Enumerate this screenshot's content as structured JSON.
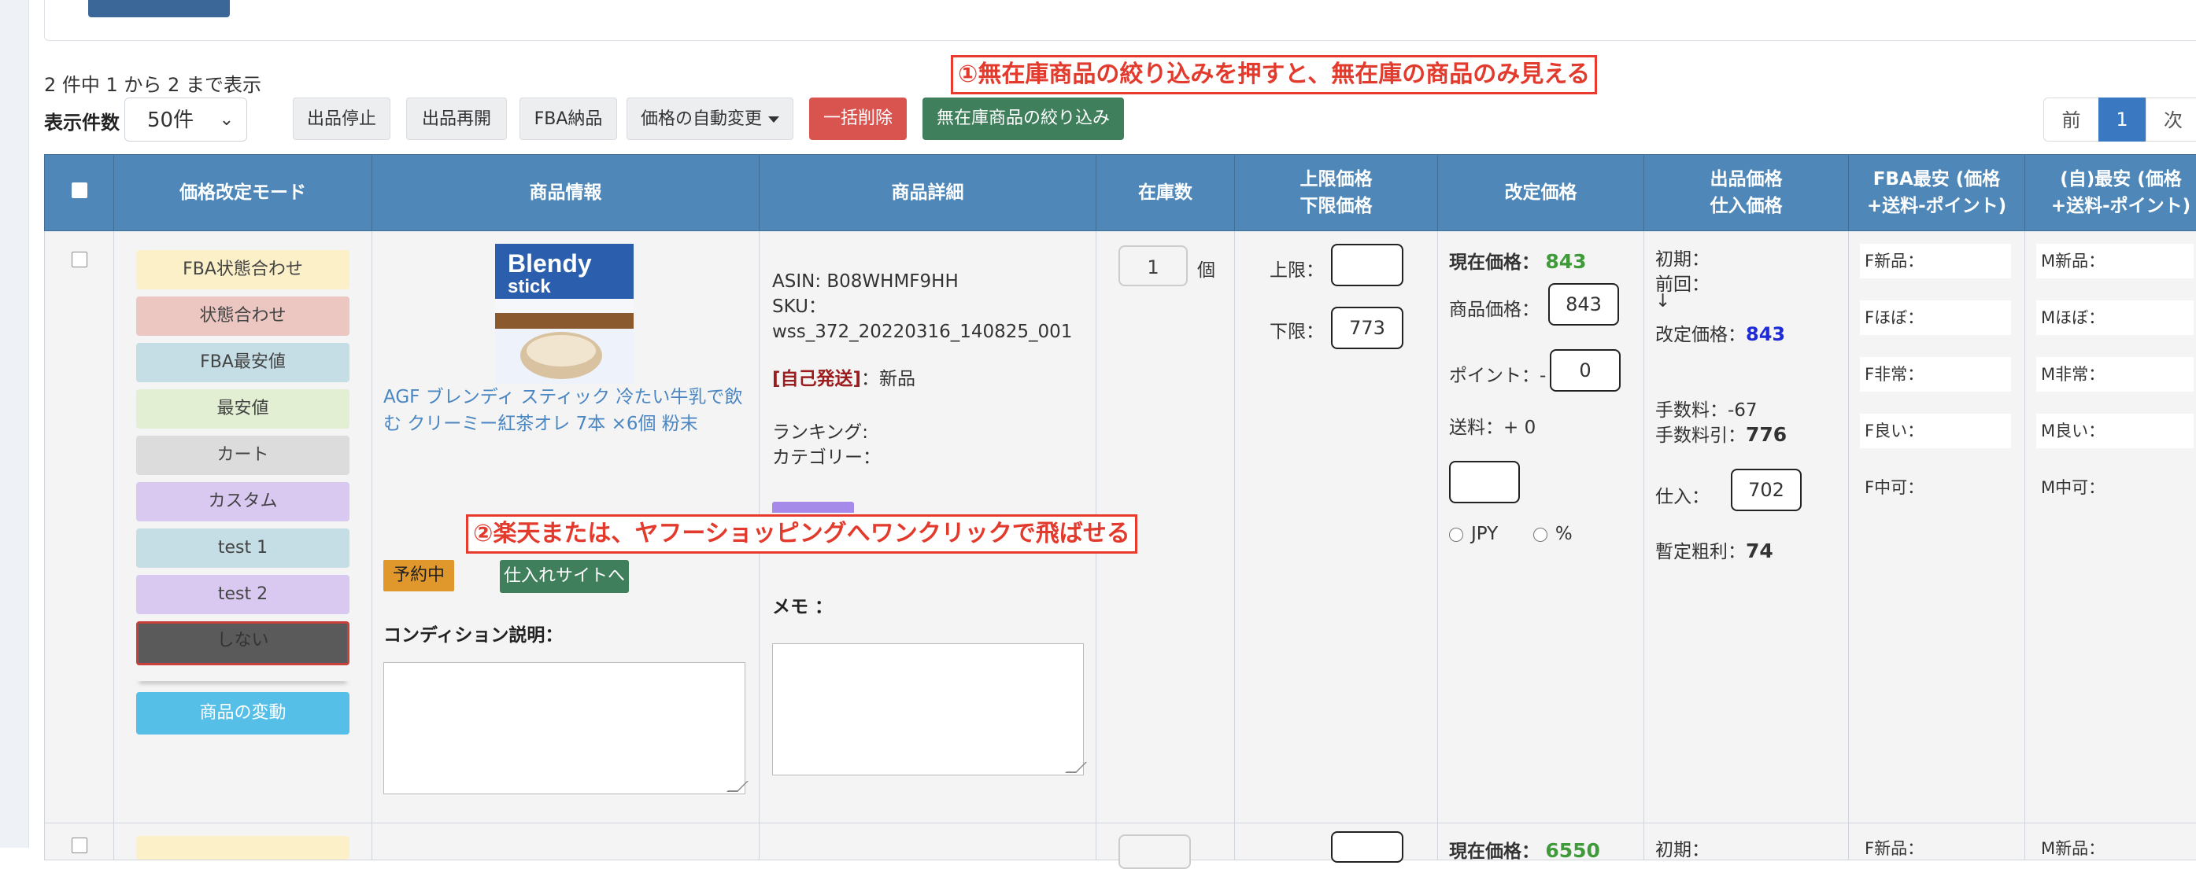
{
  "toolbar": {
    "count_text": "2 件中 1 から 2 まで表示",
    "per_page_label": "表示件数",
    "per_page_value": "50件",
    "stop_listing": "出品停止",
    "resume_listing": "出品再開",
    "fba_delivery": "FBA納品",
    "auto_price_change": "価格の自動変更",
    "bulk_delete": "一括削除",
    "filter_out_of_stock": "無在庫商品の絞り込み"
  },
  "pager": {
    "prev": "前",
    "current": "1",
    "next": "次"
  },
  "annotations": {
    "callout1": "①無在庫商品の絞り込みを押すと、無在庫の商品のみ見える",
    "callout2": "②楽天または、ヤフーショッピングへワンクリックで飛ばせる"
  },
  "table": {
    "headers": {
      "mode": "価格改定モード",
      "product_info": "商品情報",
      "product_detail": "商品詳細",
      "stock": "在庫数",
      "limits_1": "上限価格",
      "limits_2": "下限価格",
      "revised_price": "改定価格",
      "listing_1": "出品価格",
      "listing_2": "仕入価格",
      "fba_low_1": "FBA最安 (価格",
      "fba_low_2": "+送料-ポイント)",
      "self_low_1": "(自)最安 (価格",
      "self_low_2": "+送料-ポイント)"
    },
    "row1": {
      "modes": [
        "FBA状態合わせ",
        "状態合わせ",
        "FBA最安値",
        "最安値",
        "カート",
        "カスタム",
        "test 1",
        "test 2",
        "しない"
      ],
      "change_button": "商品の変動",
      "product_title": "AGF ブレンディ スティック 冷たい牛乳で飲む クリーミー紅茶オレ 7本 ×6個 粉末",
      "reserved_badge": "予約中",
      "supplier_button": "仕入れサイトへ",
      "condition_label": "コンディション説明：",
      "asin": "ASIN: B08WHMF9HH",
      "sku_label": "SKU：",
      "sku_value": "wss_372_20220316_140825_001",
      "self_ship": "[自己発送]",
      "condition": "：新品",
      "ranking": "ランキング:",
      "category": "カテゴリー：",
      "memo_label": "メモ ：",
      "stock_value": "1",
      "stock_unit": "個",
      "upper_label": "上限：",
      "upper_value": "",
      "lower_label": "下限：",
      "lower_value": "773",
      "current_price_label": "現在価格：",
      "current_price": "843",
      "item_price_label": "商品価格：",
      "item_price": "843",
      "point_label": "ポイント：-",
      "point_value": "0",
      "shipping_label": "送料：+ 0",
      "jpy_label": "JPY",
      "percent_label": "%",
      "initial_label": "初期：",
      "previous_label": "前回：",
      "arrow": "↓",
      "revised_label": "改定価格：",
      "revised_value": "843",
      "fee_text": "手数料：-67",
      "after_fee_label": "手数料引：",
      "after_fee_value": "776",
      "purchase_label": "仕入：",
      "purchase_value": "702",
      "gross_label": "暫定粗利：",
      "gross_value": "74",
      "fba_rows": [
        "F新品：",
        "Fほぼ：",
        "F非常：",
        "F良い：",
        "F中可："
      ],
      "self_rows": [
        "M新品：",
        "Mほぼ：",
        "M非常：",
        "M良い：",
        "M中可："
      ]
    },
    "row2": {
      "current_price_label": "現在価格：",
      "current_price": "6550",
      "initial_label": "初期：",
      "fba_first": "F新品：",
      "self_first": "M新品："
    }
  },
  "colors": {
    "header_bg": "#4f88b8",
    "callout_red": "#e23a2c",
    "bulk_delete": "#d9534f",
    "filter_green": "#3f7f5c",
    "mode_change": "#55bfe8",
    "link_blue": "#4a86c2"
  },
  "icons": [
    "select-all-checkbox",
    "row-checkbox",
    "chevron-down-icon",
    "caret-down-icon",
    "product-image",
    "resize-grip-icon"
  ]
}
